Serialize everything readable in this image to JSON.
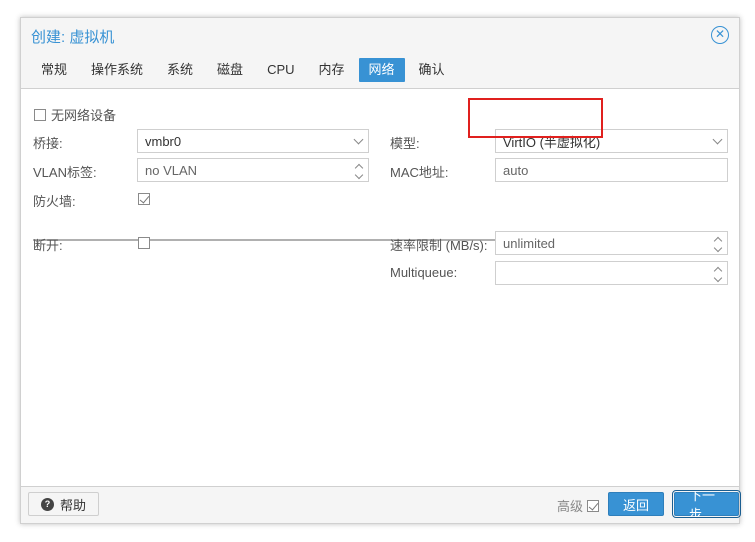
{
  "window": {
    "title": "创建: 虚拟机"
  },
  "tabs": [
    {
      "label": "常规"
    },
    {
      "label": "操作系统"
    },
    {
      "label": "系统"
    },
    {
      "label": "磁盘"
    },
    {
      "label": "CPU"
    },
    {
      "label": "内存"
    },
    {
      "label": "网络",
      "active": true
    },
    {
      "label": "确认"
    }
  ],
  "form": {
    "no_network_label": "无网络设备",
    "bridge_label": "桥接:",
    "bridge_value": "vmbr0",
    "vlan_label": "VLAN标签:",
    "vlan_value": "no VLAN",
    "firewall_label": "防火墙:",
    "model_label": "模型:",
    "model_value": "VirtIO (半虚拟化)",
    "mac_label": "MAC地址:",
    "mac_value": "auto",
    "disconnect_label": "断开:",
    "rate_label": "速率限制 (MB/s):",
    "rate_value": "unlimited",
    "multiqueue_label": "Multiqueue:",
    "multiqueue_value": ""
  },
  "footer": {
    "help_label": "帮助",
    "advanced_label": "高级",
    "back_label": "返回",
    "next_label": "下一步"
  },
  "colors": {
    "accent": "#3892d4",
    "highlight": "#e0201e"
  }
}
